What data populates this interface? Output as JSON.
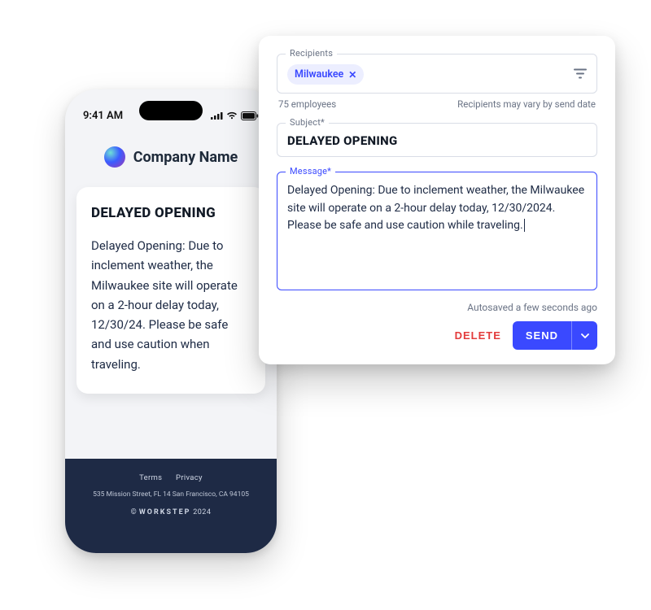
{
  "phone": {
    "time": "9:41 AM",
    "company": "Company Name",
    "card_title": "DELAYED OPENING",
    "card_body": "Delayed Opening: Due to inclement weather, the Milwaukee site will operate on a 2-hour delay today, 12/30/24. Please be safe and use caution when traveling.",
    "footer_terms": "Terms",
    "footer_privacy": "Privacy",
    "footer_address": "535 Mission Street, FL 14 San Francisco, CA 94105",
    "footer_brand": "WORKSTEP",
    "footer_year": "2024"
  },
  "form": {
    "recipients_label": "Recipients",
    "recipient_chip": "Milwaukee",
    "employee_count": "75 employees",
    "vary_note": "Recipients may vary by send date",
    "subject_label": "Subject*",
    "subject_value": "DELAYED OPENING",
    "message_label": "Message*",
    "message_value": "Delayed Opening: Due to inclement weather, the Milwaukee site will operate on a 2-hour delay today, 12/30/2024. Please be safe and use caution while traveling.",
    "autosave": "Autosaved a few seconds ago",
    "delete_label": "DELETE",
    "send_label": "SEND"
  }
}
